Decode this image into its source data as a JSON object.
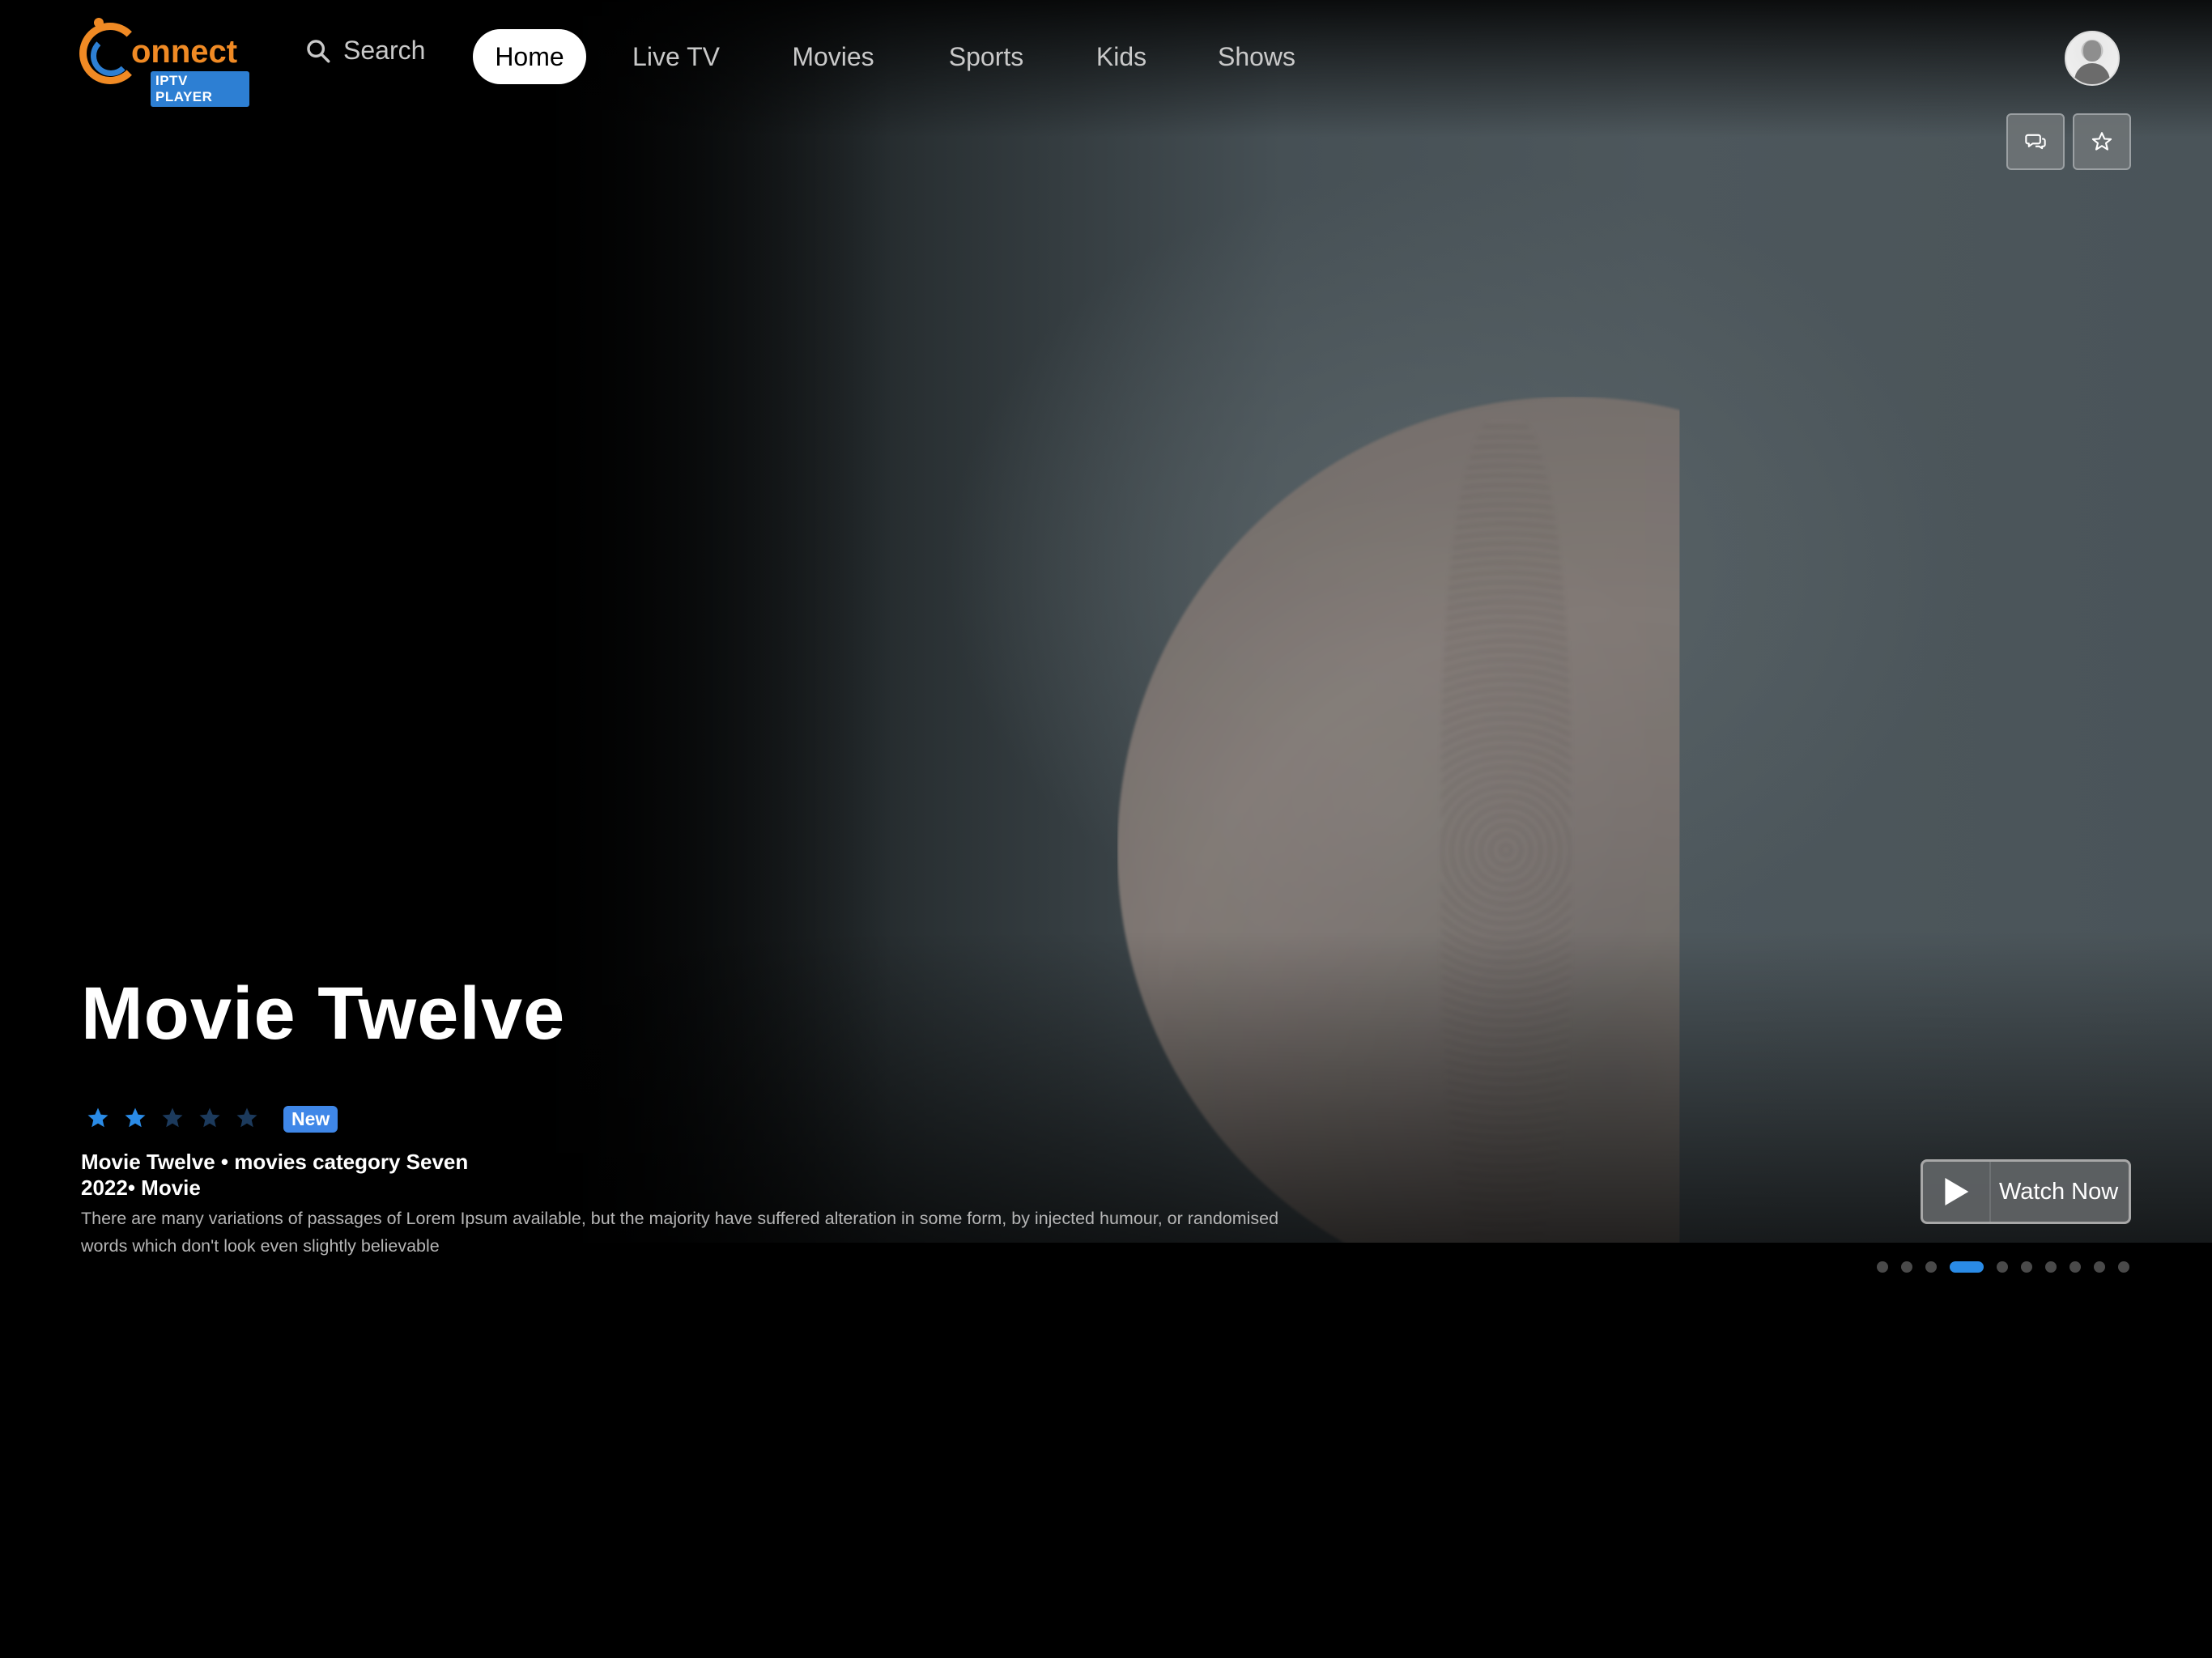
{
  "app": {
    "logo_text": "onnect",
    "logo_badge": "IPTV PLAYER"
  },
  "nav": {
    "search_label": "Search",
    "items": [
      {
        "label": "Home",
        "active": true
      },
      {
        "label": "Live TV",
        "active": false
      },
      {
        "label": "Movies",
        "active": false
      },
      {
        "label": "Sports",
        "active": false
      },
      {
        "label": "Kids",
        "active": false
      },
      {
        "label": "Shows",
        "active": false
      }
    ]
  },
  "hero": {
    "title": "Movie Twelve",
    "rating": {
      "filled": 2,
      "max": 5
    },
    "badge": "New",
    "meta_line1": "Movie Twelve • movies category Seven",
    "meta_line2": "2022• Movie",
    "description": "There are many variations of passages of Lorem Ipsum available, but the majority have suffered alteration in some form, by injected humour, or randomised words which don't look even slightly believable",
    "watch_label": "Watch Now",
    "carousel": {
      "count": 10,
      "active_index": 3
    }
  },
  "icons": {
    "search": "search-icon",
    "comment": "comment-icon",
    "favorite": "star-icon",
    "play": "play-icon",
    "avatar": "avatar"
  },
  "colors": {
    "accent": "#2a8be6",
    "logo_orange": "#f08a24",
    "logo_blue": "#2d7fd3",
    "badge_blue": "#3f87e8"
  }
}
